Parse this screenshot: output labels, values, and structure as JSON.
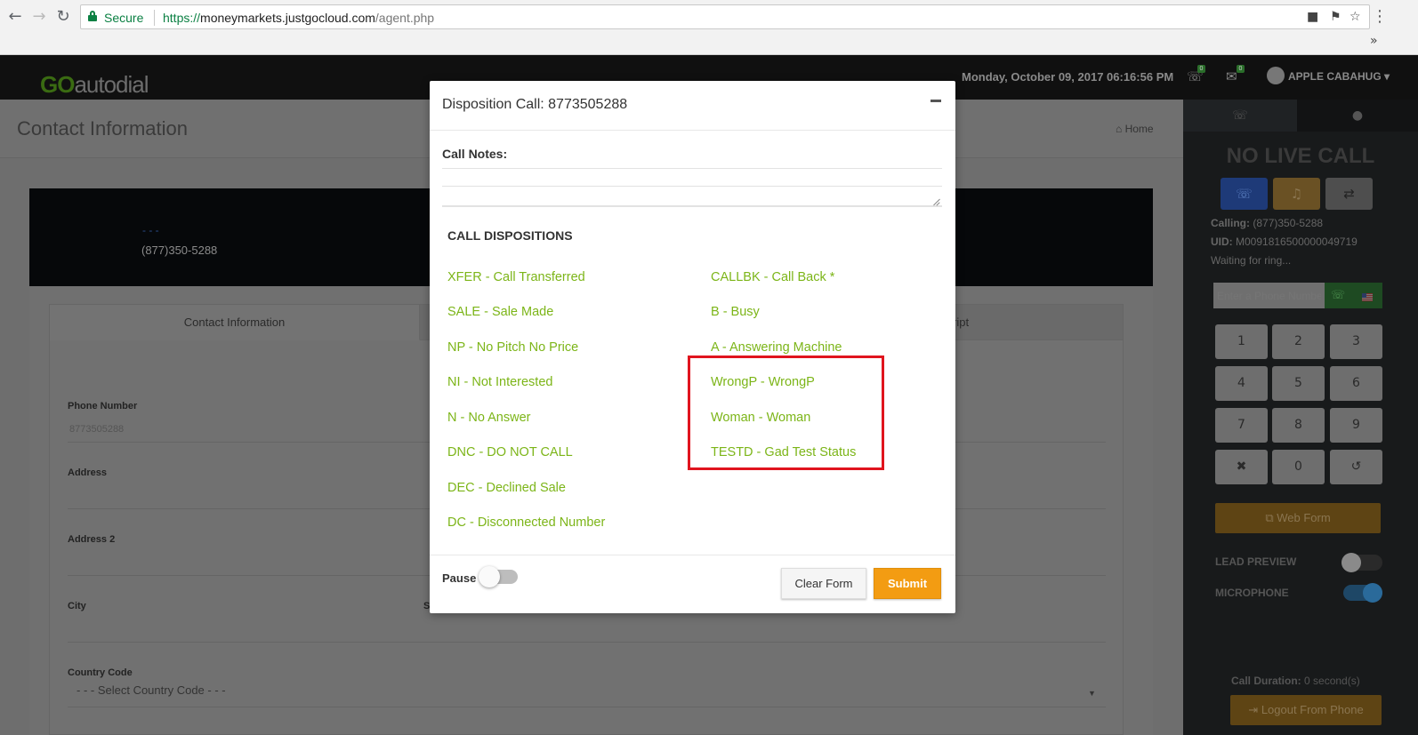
{
  "browser": {
    "secure_label": "Secure",
    "url_scheme": "https://",
    "url_host": "moneymarkets.justgocloud.com",
    "url_path": "/agent.php",
    "overflow_label": "»"
  },
  "header": {
    "logo_go": "GO",
    "logo_rest": "autodial",
    "datetime": "Monday, October 09, 2017 06:16:56 PM",
    "calls_badge": "0",
    "messages_badge": "0",
    "user_name": "APPLE CABAHUG"
  },
  "page": {
    "title": "Contact Information",
    "breadcrumb": "Home",
    "banner_dots": "- - -",
    "banner_phone": "(877)350-5288",
    "tab_contact": "Contact Information",
    "tab_script": "ript",
    "fields": {
      "phone_label": "Phone Number",
      "phone_value": "8773505288",
      "address_label": "Address",
      "address2_label": "Address 2",
      "city_label": "City",
      "city_clip": "S",
      "country_label": "Country Code",
      "country_placeholder": "- - - Select Country Code - - -"
    }
  },
  "side_panel": {
    "status": "NO LIVE CALL",
    "calling_label": "Calling:",
    "calling_value": "(877)350-5288",
    "uid_label": "UID:",
    "uid_value": "M0091816500000049719",
    "waiting": "Waiting for ring...",
    "dial_placeholder": "Enter a Phone Number",
    "keypad": [
      "1",
      "2",
      "3",
      "4",
      "5",
      "6",
      "7",
      "8",
      "9",
      "✖",
      "0",
      "↺"
    ],
    "web_form": "Web Form",
    "lead_preview": "LEAD PREVIEW",
    "microphone": "MICROPHONE",
    "call_duration_label": "Call Duration:",
    "call_duration_value": "0 second(s)",
    "logout": "Logout From Phone"
  },
  "modal": {
    "title": "Disposition Call: 8773505288",
    "notes_label": "Call Notes:",
    "dispositions_heading": "CALL DISPOSITIONS",
    "left_column": [
      "XFER - Call Transferred",
      "SALE - Sale Made",
      "NP - No Pitch No Price",
      "NI - Not Interested",
      "N - No Answer",
      "DNC - DO NOT CALL",
      "DEC - Declined Sale",
      "DC - Disconnected Number"
    ],
    "right_column": [
      "CALLBK - Call Back *",
      "B - Busy",
      "A - Answering Machine",
      "WrongP - WrongP",
      "Woman - Woman",
      "TESTD - Gad Test Status"
    ],
    "pause_label": "Pause",
    "clear_button": "Clear Form",
    "submit_button": "Submit"
  },
  "colors": {
    "disposition_link": "#7cb518",
    "submit": "#f39c12",
    "highlight": "#e0141e"
  }
}
